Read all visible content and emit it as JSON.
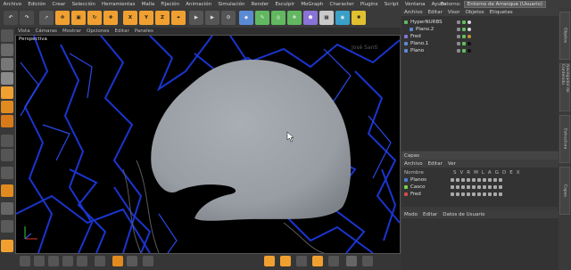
{
  "menubar": {
    "items": [
      "Archivo",
      "Edición",
      "Crear",
      "Selección",
      "Herramientas",
      "Malla",
      "Fijación",
      "Animación",
      "Simulación",
      "Render",
      "Esculpir",
      "MoGraph",
      "Character",
      "Plugins",
      "Script",
      "Ventana",
      "Ayuda"
    ],
    "env_label": "Entorno:",
    "env_value": "Entorno de Arranque (Usuario)"
  },
  "toolbar": {
    "axis_x": "X",
    "axis_y": "Y",
    "axis_z": "Z"
  },
  "viewport": {
    "menu": [
      "Vista",
      "Cámaras",
      "Mostrar",
      "Opciones",
      "Editar",
      "Paneles"
    ],
    "title": "Perspectiva",
    "watermark": "José Santi"
  },
  "objects": {
    "menu": [
      "Archivo",
      "Editar",
      "Visor",
      "Objetos",
      "Etiquetas"
    ],
    "items": [
      {
        "name": "HyperNURBS",
        "indent": 0
      },
      {
        "name": "Plano.2",
        "indent": 1
      },
      {
        "name": "Fred",
        "indent": 0
      },
      {
        "name": "Plano.1",
        "indent": 0
      },
      {
        "name": "Plano",
        "indent": 0
      }
    ]
  },
  "layers": {
    "title": "Capas",
    "menu": [
      "Archivo",
      "Editar",
      "Ver"
    ],
    "column_name": "Nombre",
    "columns": [
      "S",
      "V",
      "R",
      "M",
      "L",
      "A",
      "G",
      "D",
      "E",
      "X"
    ],
    "items": [
      {
        "name": "Planos",
        "color": "#4a7fd4"
      },
      {
        "name": "Casco",
        "color": "#7ad24a"
      },
      {
        "name": "Fred",
        "color": "#d44a4a"
      }
    ]
  },
  "attributes": {
    "menu": [
      "Modo",
      "Editar",
      "Datos de Usuario"
    ]
  },
  "right_tabs": [
    "Objetos",
    "Navegador de Contenido",
    "Estructura",
    "Capas"
  ],
  "colors": {
    "accent_orange": "#f0a030",
    "wire_blue": "#1a35d0",
    "model_grey": "#9ea3a9"
  }
}
